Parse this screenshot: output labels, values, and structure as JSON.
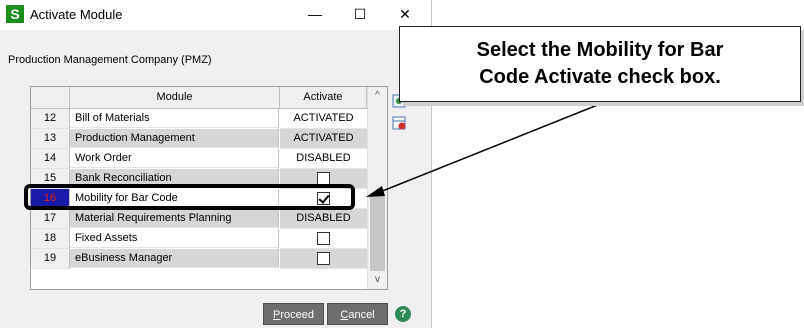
{
  "window": {
    "icon_letter": "S",
    "title": "Activate Module",
    "minimize_glyph": "—",
    "maximize_glyph": "☐",
    "close_glyph": "✕"
  },
  "company": "Production Management Company (PMZ)",
  "grid": {
    "headers": {
      "module": "Module",
      "activate": "Activate"
    },
    "rows": [
      {
        "num": "12",
        "module": "Bill of Materials",
        "activate": "ACTIVATED"
      },
      {
        "num": "13",
        "module": "Production Management",
        "activate": "ACTIVATED"
      },
      {
        "num": "14",
        "module": "Work Order",
        "activate": "DISABLED"
      },
      {
        "num": "15",
        "module": "Bank Reconciliation",
        "activate": "",
        "checkbox": false
      },
      {
        "num": "16",
        "module": "Mobility for Bar Code",
        "activate": "",
        "checkbox": true
      },
      {
        "num": "17",
        "module": "Material Requirements Planning",
        "activate": "DISABLED"
      },
      {
        "num": "18",
        "module": "Fixed Assets",
        "activate": "",
        "checkbox": false
      },
      {
        "num": "19",
        "module": "eBusiness Manager",
        "activate": "",
        "checkbox": false
      }
    ],
    "scroll_up_glyph": "^",
    "scroll_down_glyph": "v"
  },
  "buttons": {
    "proceed_prefix": "P",
    "proceed_rest": "roceed",
    "cancel_prefix": "C",
    "cancel_rest": "ancel",
    "help_glyph": "?"
  },
  "callout": {
    "line1": "Select the Mobility for Bar",
    "line2": "Code Activate check box."
  },
  "colors": {
    "selected_row_bg": "#1a1aa8",
    "selected_row_text": "#e02020",
    "button_bg": "#6e6e6e",
    "app_icon": "#1e8e1e"
  }
}
